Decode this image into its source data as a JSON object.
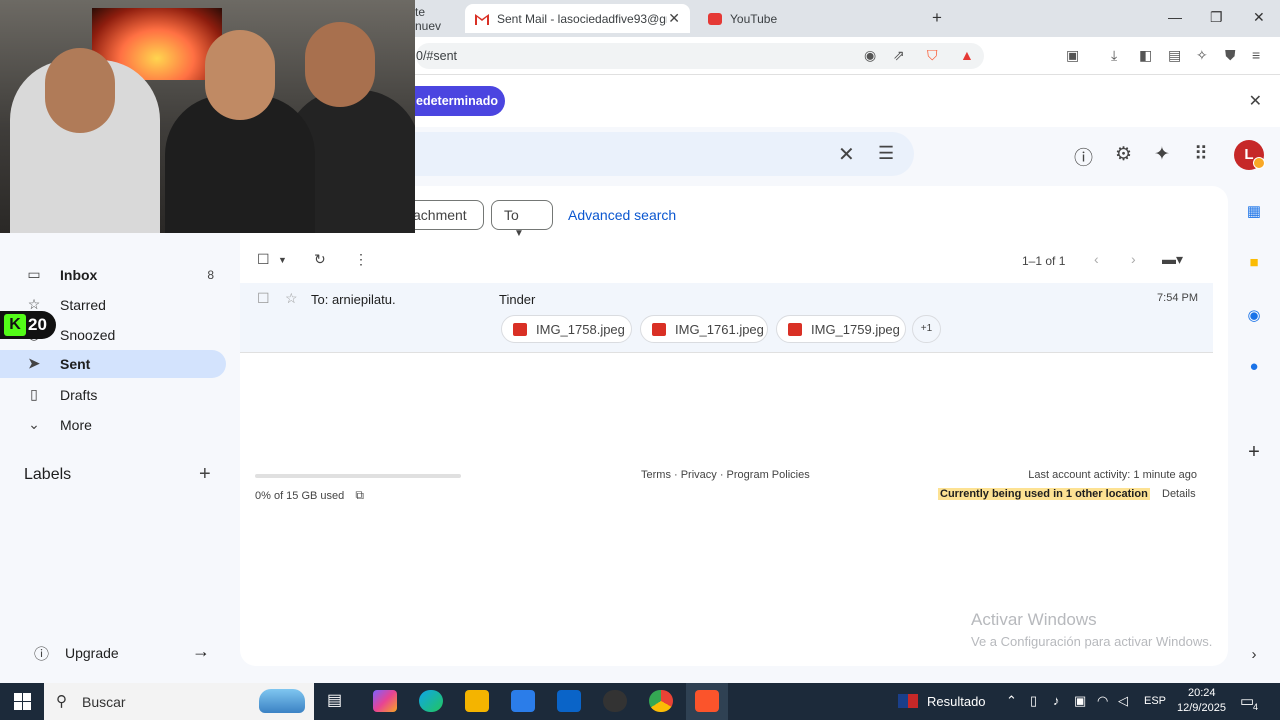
{
  "browser": {
    "tabs": [
      {
        "label": "te nuev",
        "active": false
      },
      {
        "label": "Sent Mail - lasociedadfive93@gm",
        "active": true
      },
      {
        "label": "YouTube",
        "active": false
      }
    ],
    "new_tab": "+",
    "url": "0/#sent",
    "shield_badge": "0",
    "rewards_badge": "1"
  },
  "banner": {
    "button_label": "edeterminado",
    "close": "✕"
  },
  "header": {
    "avatar_letter": "L"
  },
  "filters": {
    "attachment_chip": "achment",
    "to_chip": "To",
    "advanced_search": "Advanced search"
  },
  "nav": {
    "items": [
      {
        "label": "Inbox",
        "count": "8"
      },
      {
        "label": "Starred"
      },
      {
        "label": "Snoozed"
      },
      {
        "label": "Sent"
      },
      {
        "label": "Drafts"
      },
      {
        "label": "More"
      }
    ],
    "labels_title": "Labels",
    "upgrade": "Upgrade"
  },
  "toolbar": {
    "pager": "1–1 of 1"
  },
  "mail": {
    "recipient": "To: arniepilatu.",
    "subject": "Tinder",
    "time": "7:54 PM",
    "attachments": [
      "IMG_1758.jpeg",
      "IMG_1761.jpeg",
      "IMG_1759.jpeg"
    ],
    "more_attachments": "+1"
  },
  "footer": {
    "storage": "0% of 15 GB used",
    "links": "Terms · Privacy · Program Policies",
    "activity": "Last account activity: 1 minute ago",
    "other_location": "Currently being used in 1 other location",
    "details": "Details"
  },
  "watermark": {
    "line1": "Activar Windows",
    "line2": "Ve a Configuración para activar Windows."
  },
  "overlay": {
    "kick_count": "20"
  },
  "taskbar": {
    "search_placeholder": "Buscar",
    "weather": "Resultado",
    "language": "ESP",
    "time": "20:24",
    "date": "12/9/2025",
    "notification_count": "4"
  },
  "colors": {
    "accent_blue": "#0b57d0",
    "banner_button": "#4b45e0",
    "sent_active": "#d3e3fd",
    "highlight": "#fde293"
  }
}
